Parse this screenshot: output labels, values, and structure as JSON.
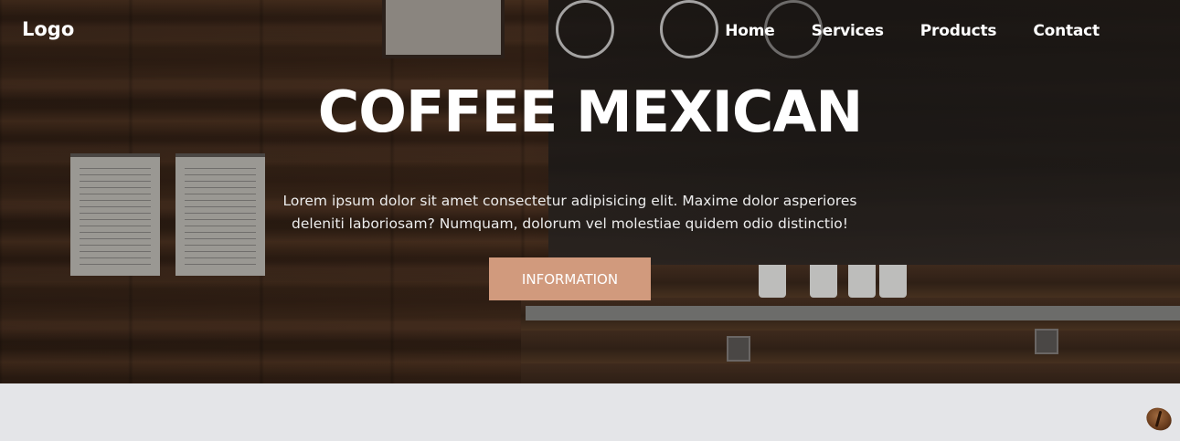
{
  "navbar": {
    "logo": "Logo",
    "links": [
      "Home",
      "Services",
      "Products",
      "Contact"
    ]
  },
  "hero": {
    "title": "COFFEE MEXICAN",
    "text": "Lorem ipsum dolor sit amet consectetur adipisicing elit. Maxime dolor asperiores deleniti laboriosam? Numquam, dolorum vel molestiae quidem odio distinctio!",
    "button_label": "INFORMATION"
  },
  "colors": {
    "button": "#d19a7d",
    "section_bg": "#e4e5e8"
  },
  "icons": {
    "decoration": "coffee-bean-icon"
  }
}
